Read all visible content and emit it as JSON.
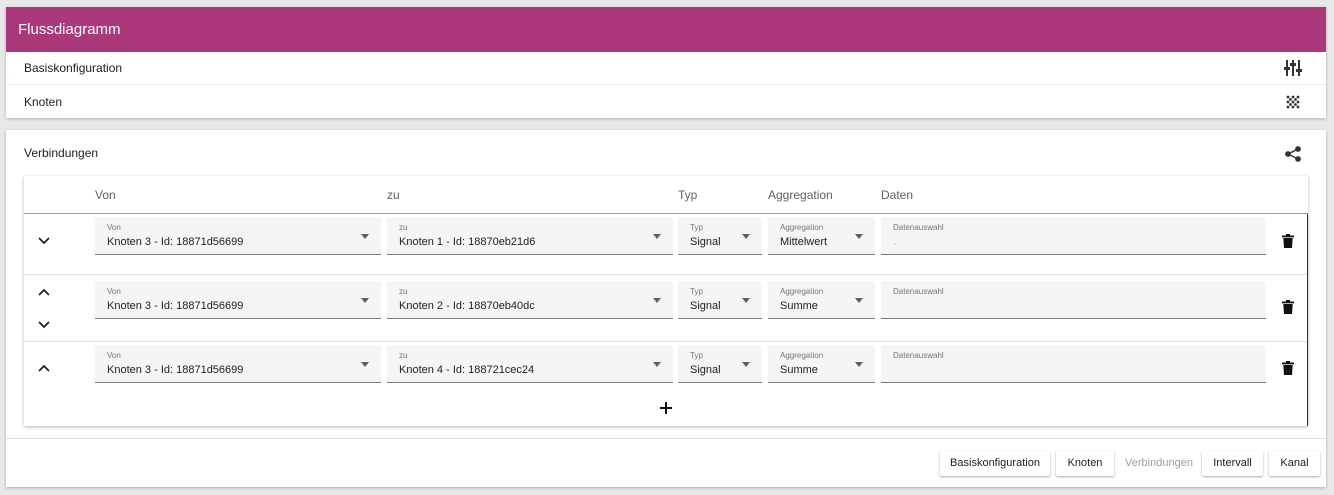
{
  "header": {
    "title": "Flussdiagramm"
  },
  "panels": [
    {
      "label": "Basiskonfiguration",
      "icon": "tune-icon"
    },
    {
      "label": "Knoten",
      "icon": "grain-icon"
    }
  ],
  "connections_section": {
    "title": "Verbindungen",
    "icon": "share-icon",
    "columns": [
      "Von",
      "zu",
      "Typ",
      "Aggregation",
      "Daten"
    ],
    "rows": [
      {
        "von_label": "Von",
        "von": "Knoten 3 - Id: 18871d56699",
        "zu_label": "zu",
        "zu": "Knoten 1 - Id: 18870eb21d6",
        "typ_label": "Typ",
        "typ": "Signal",
        "agg_label": "Aggregation",
        "agg": "Mittelwert",
        "daten_label": "Datenauswahl",
        "daten": "."
      },
      {
        "von_label": "Von",
        "von": "Knoten 3 - Id: 18871d56699",
        "zu_label": "zu",
        "zu": "Knoten 2 - Id: 18870eb40dc",
        "typ_label": "Typ",
        "typ": "Signal",
        "agg_label": "Aggregation",
        "agg": "Summe",
        "daten_label": "Datenauswahl",
        "daten": ""
      },
      {
        "von_label": "Von",
        "von": "Knoten 3 - Id: 18871d56699",
        "zu_label": "zu",
        "zu": "Knoten 4 - Id: 188721cec24",
        "typ_label": "Typ",
        "typ": "Signal",
        "agg_label": "Aggregation",
        "agg": "Summe",
        "daten_label": "Datenauswahl",
        "daten": ""
      }
    ],
    "add_icon": "plus-icon"
  },
  "footer": {
    "buttons": [
      {
        "label": "Basiskonfiguration",
        "enabled": true
      },
      {
        "label": "Knoten",
        "enabled": true
      },
      {
        "label": "Verbindungen",
        "enabled": false
      },
      {
        "label": "Intervall",
        "enabled": true
      },
      {
        "label": "Kanal",
        "enabled": true
      }
    ]
  },
  "colors": {
    "header_bg": "#ab387a",
    "header_text": "#ffffff"
  }
}
